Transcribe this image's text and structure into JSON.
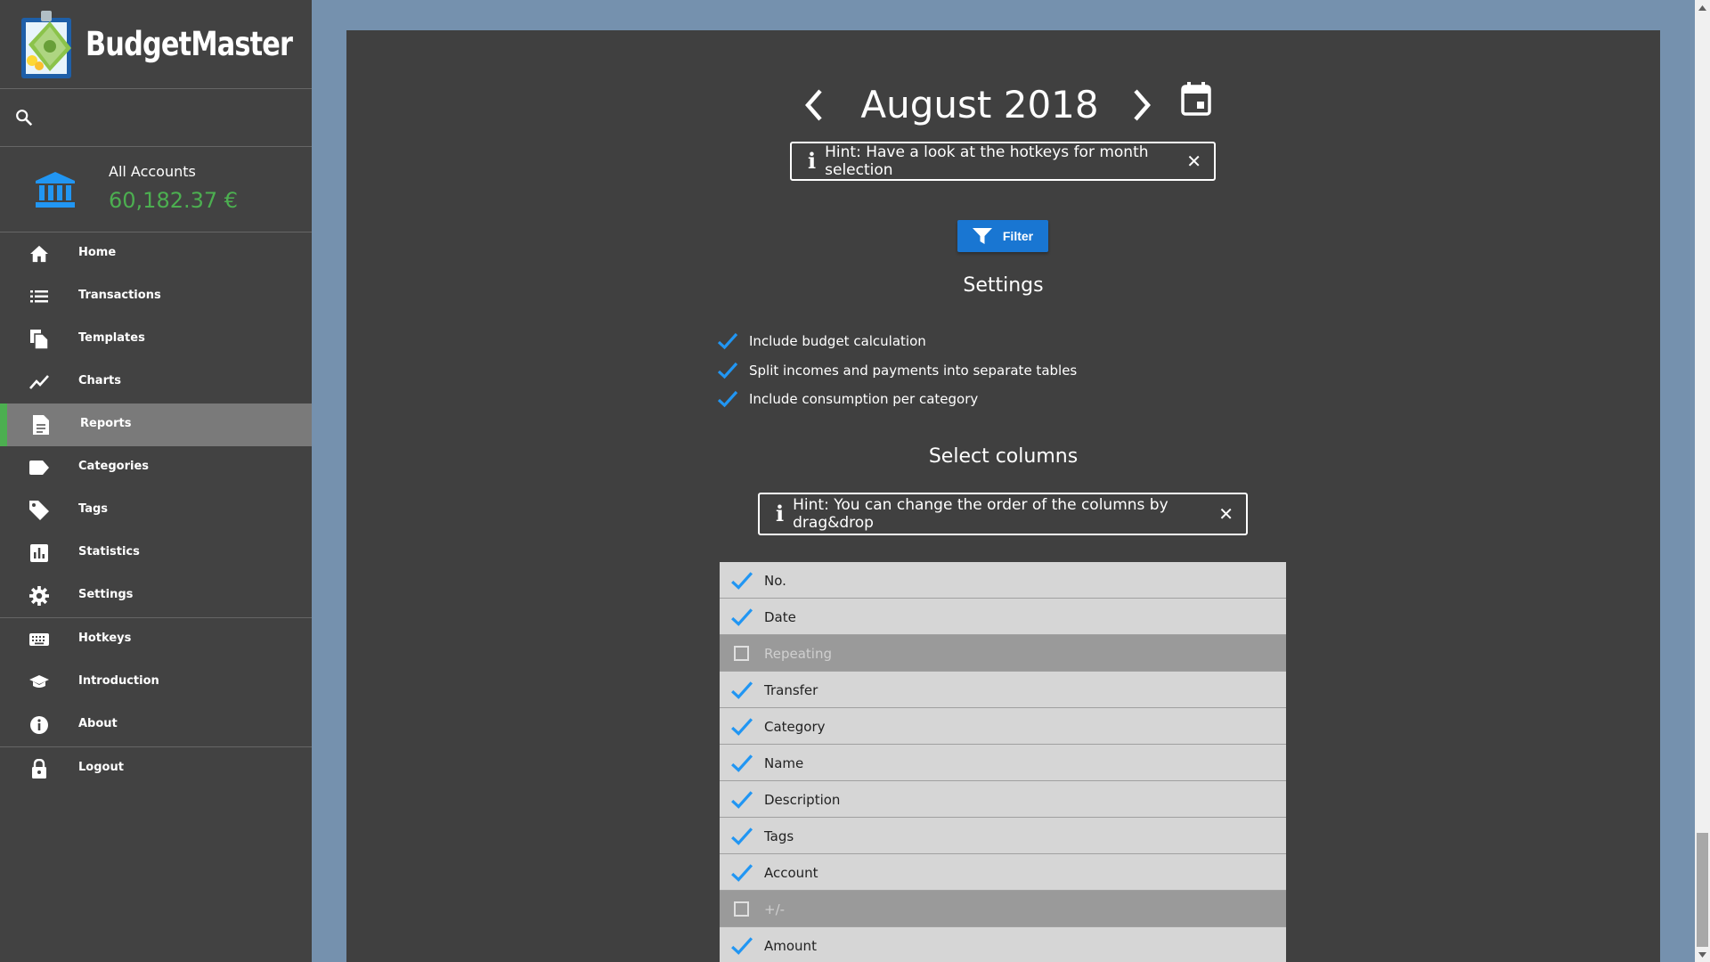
{
  "app": {
    "title": "BudgetMaster"
  },
  "search": {
    "placeholder": ""
  },
  "account": {
    "name": "All Accounts",
    "balance": "60,182.37 €",
    "balance_color": "#4caf50"
  },
  "sidebar": {
    "items": [
      {
        "id": "home",
        "label": "Home",
        "icon": "home-icon"
      },
      {
        "id": "transactions",
        "label": "Transactions",
        "icon": "list-icon"
      },
      {
        "id": "templates",
        "label": "Templates",
        "icon": "copy-icon"
      },
      {
        "id": "charts",
        "label": "Charts",
        "icon": "line-chart-icon"
      },
      {
        "id": "reports",
        "label": "Reports",
        "icon": "document-icon",
        "active": true
      },
      {
        "id": "categories",
        "label": "Categories",
        "icon": "label-icon"
      },
      {
        "id": "tags",
        "label": "Tags",
        "icon": "tag-icon"
      },
      {
        "id": "statistics",
        "label": "Statistics",
        "icon": "bar-chart-icon"
      },
      {
        "id": "settings",
        "label": "Settings",
        "icon": "gear-icon"
      },
      {
        "id": "hotkeys",
        "label": "Hotkeys",
        "icon": "keyboard-icon"
      },
      {
        "id": "introduction",
        "label": "Introduction",
        "icon": "graduation-cap-icon"
      },
      {
        "id": "about",
        "label": "About",
        "icon": "info-icon"
      },
      {
        "id": "logout",
        "label": "Logout",
        "icon": "lock-icon"
      }
    ]
  },
  "month": {
    "label": "August 2018"
  },
  "hints": {
    "month": "Hint: Have a look at the hotkeys for month selection",
    "columns": "Hint: You can change the order of the columns by drag&drop"
  },
  "filter": {
    "label": "Filter"
  },
  "settings": {
    "heading": "Settings",
    "options": [
      {
        "label": "Include budget calculation",
        "checked": true
      },
      {
        "label": "Split incomes and payments into separate tables",
        "checked": true
      },
      {
        "label": "Include consumption per category",
        "checked": true
      }
    ]
  },
  "columns": {
    "heading": "Select columns",
    "items": [
      {
        "label": "No.",
        "checked": true
      },
      {
        "label": "Date",
        "checked": true
      },
      {
        "label": "Repeating",
        "checked": false
      },
      {
        "label": "Transfer",
        "checked": true
      },
      {
        "label": "Category",
        "checked": true
      },
      {
        "label": "Name",
        "checked": true
      },
      {
        "label": "Description",
        "checked": true
      },
      {
        "label": "Tags",
        "checked": true
      },
      {
        "label": "Account",
        "checked": true
      },
      {
        "label": "+/-",
        "checked": false
      },
      {
        "label": "Amount",
        "checked": true
      }
    ]
  },
  "colors": {
    "accent": "#1976d2",
    "check": "#2196f3",
    "sidebar": "#424242",
    "panel": "#404040",
    "background": "#7591ae",
    "active_indicator": "#4caf50"
  }
}
